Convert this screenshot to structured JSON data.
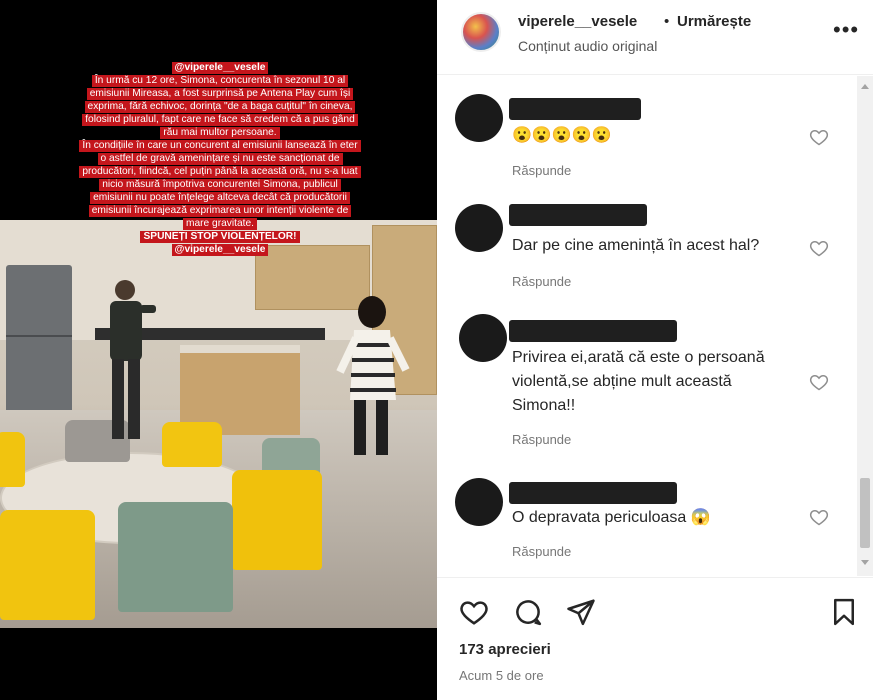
{
  "post": {
    "caption_lines": [
      "@viperele__vesele",
      "În urmă cu 12 ore, Simona, concurenta în sezonul 10 al",
      "emisiunii Mireasa, a fost surprinsă pe Antena Play cum își",
      "exprima, fără echivoc, dorința \"de a baga cuțitul\" în cineva,",
      "folosind pluralul, fapt care ne face să credem că a pus gând",
      "rău mai multor persoane.",
      "În condițiile în care un concurent al emisiunii lansează în eter",
      "o astfel de gravă amenințare și nu este sancționat de",
      "producători, fiindcă, cel puțin până la această oră, nu s-a luat",
      "nicio măsură împotriva concurentei Simona, publicul",
      "emisiunii nu poate înțelege altceva decât că producătorii",
      "emisiunii încurajează exprimarea unor intenții violente de",
      "mare gravitate.",
      "SPUNEȚI STOP VIOLENȚELOR!",
      "@viperele__vesele"
    ],
    "caption_bg": "#c4161c"
  },
  "header": {
    "username": "viperele__vesele",
    "separator": "•",
    "follow_label": "Urmărește",
    "audio_label": "Conținut audio original",
    "more_icon": "more-horizontal-icon"
  },
  "comments": [
    {
      "username": "",
      "text": "😮😮😮😮😮",
      "reply_label": "Răspunde"
    },
    {
      "username": "",
      "text": "Dar pe cine amenință în acest hal?",
      "reply_label": "Răspunde"
    },
    {
      "username": "",
      "text_lines": [
        "Privirea ei,arată că este o persoană",
        "violentă,se abține mult această",
        "Simona!!"
      ],
      "reply_label": "Răspunde"
    },
    {
      "username": "",
      "text": "O depravata periculoasa 😱",
      "reply_label": "Răspunde"
    }
  ],
  "footer": {
    "likes": "173 aprecieri",
    "time": "Acum 5 de ore",
    "icons": [
      "heart-icon",
      "comment-icon",
      "share-icon",
      "bookmark-icon"
    ]
  },
  "colors": {
    "text": "#262626",
    "secondary": "#777777",
    "divider": "#efefef"
  }
}
